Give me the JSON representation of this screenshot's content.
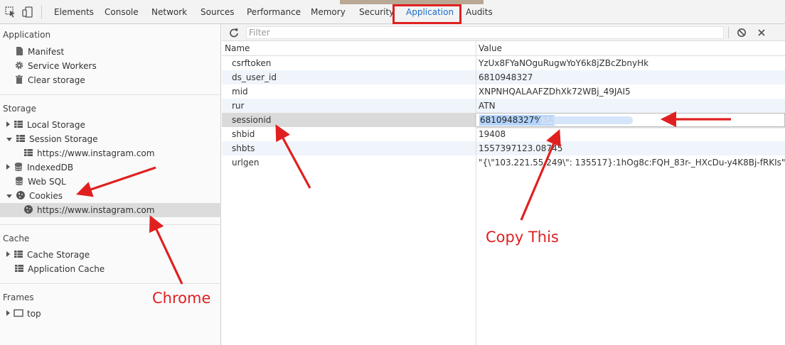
{
  "toolbar_tabs": [
    "Elements",
    "Console",
    "Network",
    "Sources",
    "Performance",
    "Memory",
    "Security",
    "Application",
    "Audits"
  ],
  "active_tab": "Application",
  "sidebar": {
    "application": {
      "title": "Application",
      "items": [
        "Manifest",
        "Service Workers",
        "Clear storage"
      ]
    },
    "storage": {
      "title": "Storage",
      "local_storage": "Local Storage",
      "session_storage": "Session Storage",
      "session_storage_child": "https://www.instagram.com",
      "indexeddb": "IndexedDB",
      "web_sql": "Web SQL",
      "cookies": "Cookies",
      "cookies_child": "https://www.instagram.com"
    },
    "cache": {
      "title": "Cache",
      "items": [
        "Cache Storage",
        "Application Cache"
      ]
    },
    "frames": {
      "title": "Frames",
      "top": "top"
    }
  },
  "main": {
    "filter_placeholder": "Filter",
    "columns": {
      "name": "Name",
      "value": "Value"
    },
    "rows": [
      {
        "name": "csrftoken",
        "value": "YzUx8FYaNOguRugwYoY6k8jZBcZbnyHk"
      },
      {
        "name": "ds_user_id",
        "value": "6810948327"
      },
      {
        "name": "mid",
        "value": "XNPNHQALAAFZDhXk72WBj_49JAI5"
      },
      {
        "name": "rur",
        "value": "ATN"
      },
      {
        "name": "sessionid",
        "value": "6810948327%3A"
      },
      {
        "name": "shbid",
        "value": "19408"
      },
      {
        "name": "shbts",
        "value": "1557397123.08745"
      },
      {
        "name": "urlgen",
        "value": "\"{\\\"103.221.55.249\\\": 135517}:1hOg8c:FQH_83r-_HXcDu-y4K8Bj-fRKIs\""
      }
    ]
  },
  "annotations": {
    "copy_text": "Copy This",
    "chrome_text": "Chrome",
    "color": "#e02020"
  }
}
